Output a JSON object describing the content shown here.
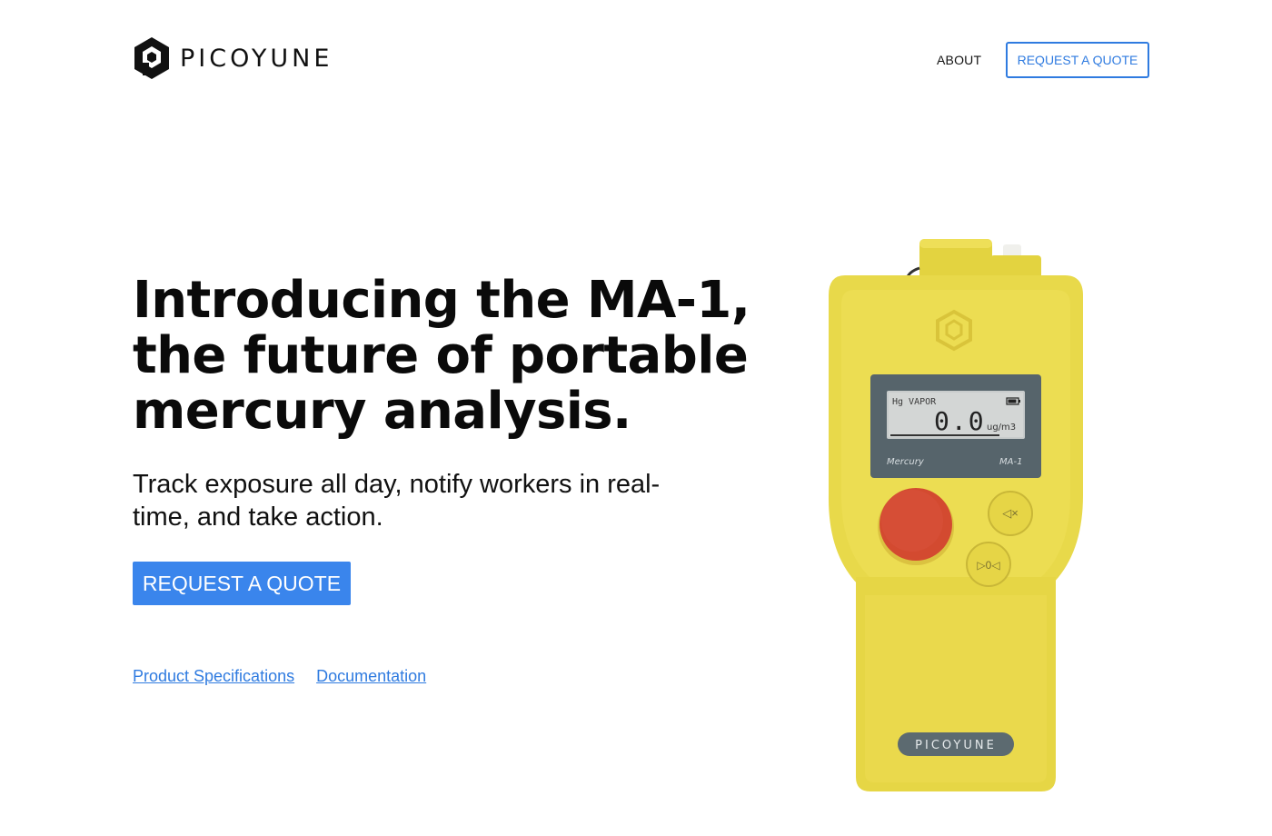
{
  "header": {
    "logo_text": "PICOYUNE",
    "nav": {
      "about_label": "ABOUT",
      "quote_label": "REQUEST A QUOTE"
    }
  },
  "hero": {
    "headline_lines": [
      "Introducing the MA-1,",
      "the future of portable",
      "mercury analysis."
    ],
    "subheadline": "Track exposure all day, notify workers in real-time, and take action.",
    "cta_label": "REQUEST A QUOTE",
    "links": [
      {
        "label": "Product Specifications"
      },
      {
        "label": "Documentation"
      }
    ]
  },
  "device": {
    "lcd": {
      "title": "Hg VAPOR",
      "value": "0.0",
      "unit": "ug/m3"
    },
    "panel_left": "Mercury",
    "panel_right": "MA-1",
    "mute_button_glyph": "◁×",
    "zero_button_glyph": "▷0◁",
    "badge": "PICOYUNE"
  },
  "colors": {
    "accent": "#3a85ec",
    "link": "#2f7be0",
    "device_body": "#e8d94a",
    "device_screen": "#56646b",
    "main_button": "#d34a30"
  }
}
